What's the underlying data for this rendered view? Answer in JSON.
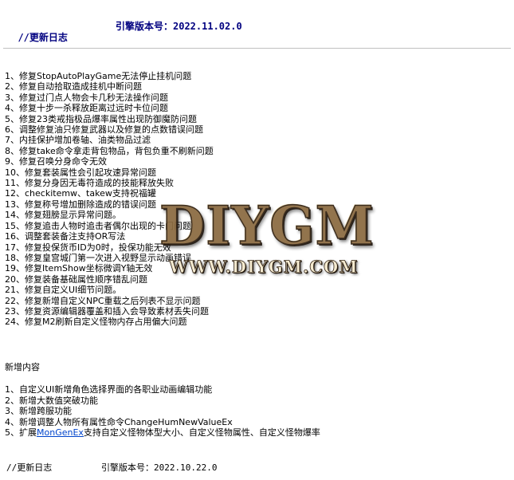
{
  "header": {
    "title": "//更新日志",
    "engine_version": "引擎版本号：2022.11.02.0"
  },
  "fixes": [
    "1、修复StopAutoPlayGame无法停止挂机问题",
    "2、修复自动拾取造成挂机中断问题",
    "3、修复过门点人物会卡几秒无法操作问题",
    "4、修复十步一杀释放距离过远时卡位问题",
    "5、修复23类戒指极品爆率属性出现防御魔防问题",
    "6、调整修复油只修复武器以及修复的点数错误问题",
    "7、内挂保护增加卷轴、油类物品过滤",
    "8、修复take命令拿走背包物品，背包负重不刷新问题",
    "9、修复召唤分身命令无效",
    "10、修复套装属性会引起攻速异常问题",
    "11、修复分身因无毒符造成的技能释放失败",
    "12、checkitemw、takew支持祝福罐",
    "13、修复称号增加删除造成的错误问题",
    "14、修复翅膀显示异常问题。",
    "15、修复追击人物时追击者偶尔出现的卡门问题",
    "16、调整套装备注支持OR写法",
    "17、修复投保货币ID为0时，投保功能无效",
    "18、修复皇宫城门第一次进入视野显示动画错误",
    "19、修复ItemShow坐标微调Y轴无效",
    "20、修复装备基础属性顺序错乱问题",
    "21、修复自定义UI细节问题。",
    "22、修复新增自定义NPC重载之后列表不显示问题",
    "23、修复资源编辑器覆盖和插入会导致素材丢失问题",
    "24、修复M2刷新自定义怪物内存占用偏大问题"
  ],
  "new_section": {
    "title": "新增内容",
    "items": [
      "1、自定义UI新增角色选择界面的各职业动画编辑功能",
      "2、新增大数值突破功能",
      "3、新增跨服功能",
      "4、新增调整人物所有属性命令ChangeHumNewValueEx"
    ],
    "item5_prefix": "5、扩展",
    "item5_link": "MonGenEx",
    "item5_suffix": "支持自定义怪物体型大小、自定义怪物属性、自定义怪物爆率"
  },
  "footer": {
    "title": "//更新日志",
    "engine_version": "引擎版本号：2022.10.22.0"
  },
  "watermark": {
    "main": "DIYGM",
    "sub": "WWW.DIYGM.COM"
  },
  "colors": {
    "header_text": "#000080",
    "link": "#0044cc",
    "rule": "#c0c0c0",
    "watermark_bronze": "#8a6a40"
  }
}
